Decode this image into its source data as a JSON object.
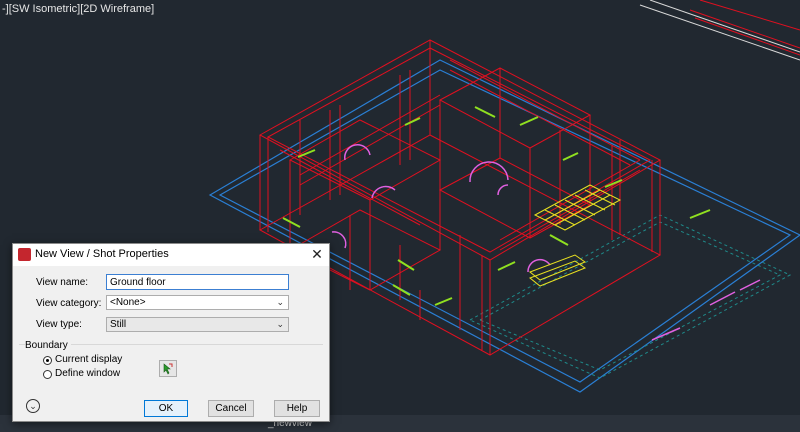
{
  "viewport": {
    "label": "-][SW Isometric][2D Wireframe]",
    "tab_label": "_newview"
  },
  "dialog": {
    "title": "New View / Shot Properties",
    "fields": {
      "view_name_label": "View name:",
      "view_name_value": "Ground floor",
      "view_category_label": "View category:",
      "view_category_value": "<None>",
      "view_type_label": "View type:",
      "view_type_value": "Still"
    },
    "boundary": {
      "title": "Boundary",
      "current_display_label": "Current display",
      "define_window_label": "Define window",
      "selected": "current_display"
    },
    "buttons": {
      "ok": "OK",
      "cancel": "Cancel",
      "help": "Help"
    }
  },
  "colors": {
    "background": "#212830",
    "walls": "#e01020",
    "outline": "#2a7fd4",
    "doors": "#e060e0",
    "windows": "#90e020",
    "stairs": "#e8e020"
  }
}
